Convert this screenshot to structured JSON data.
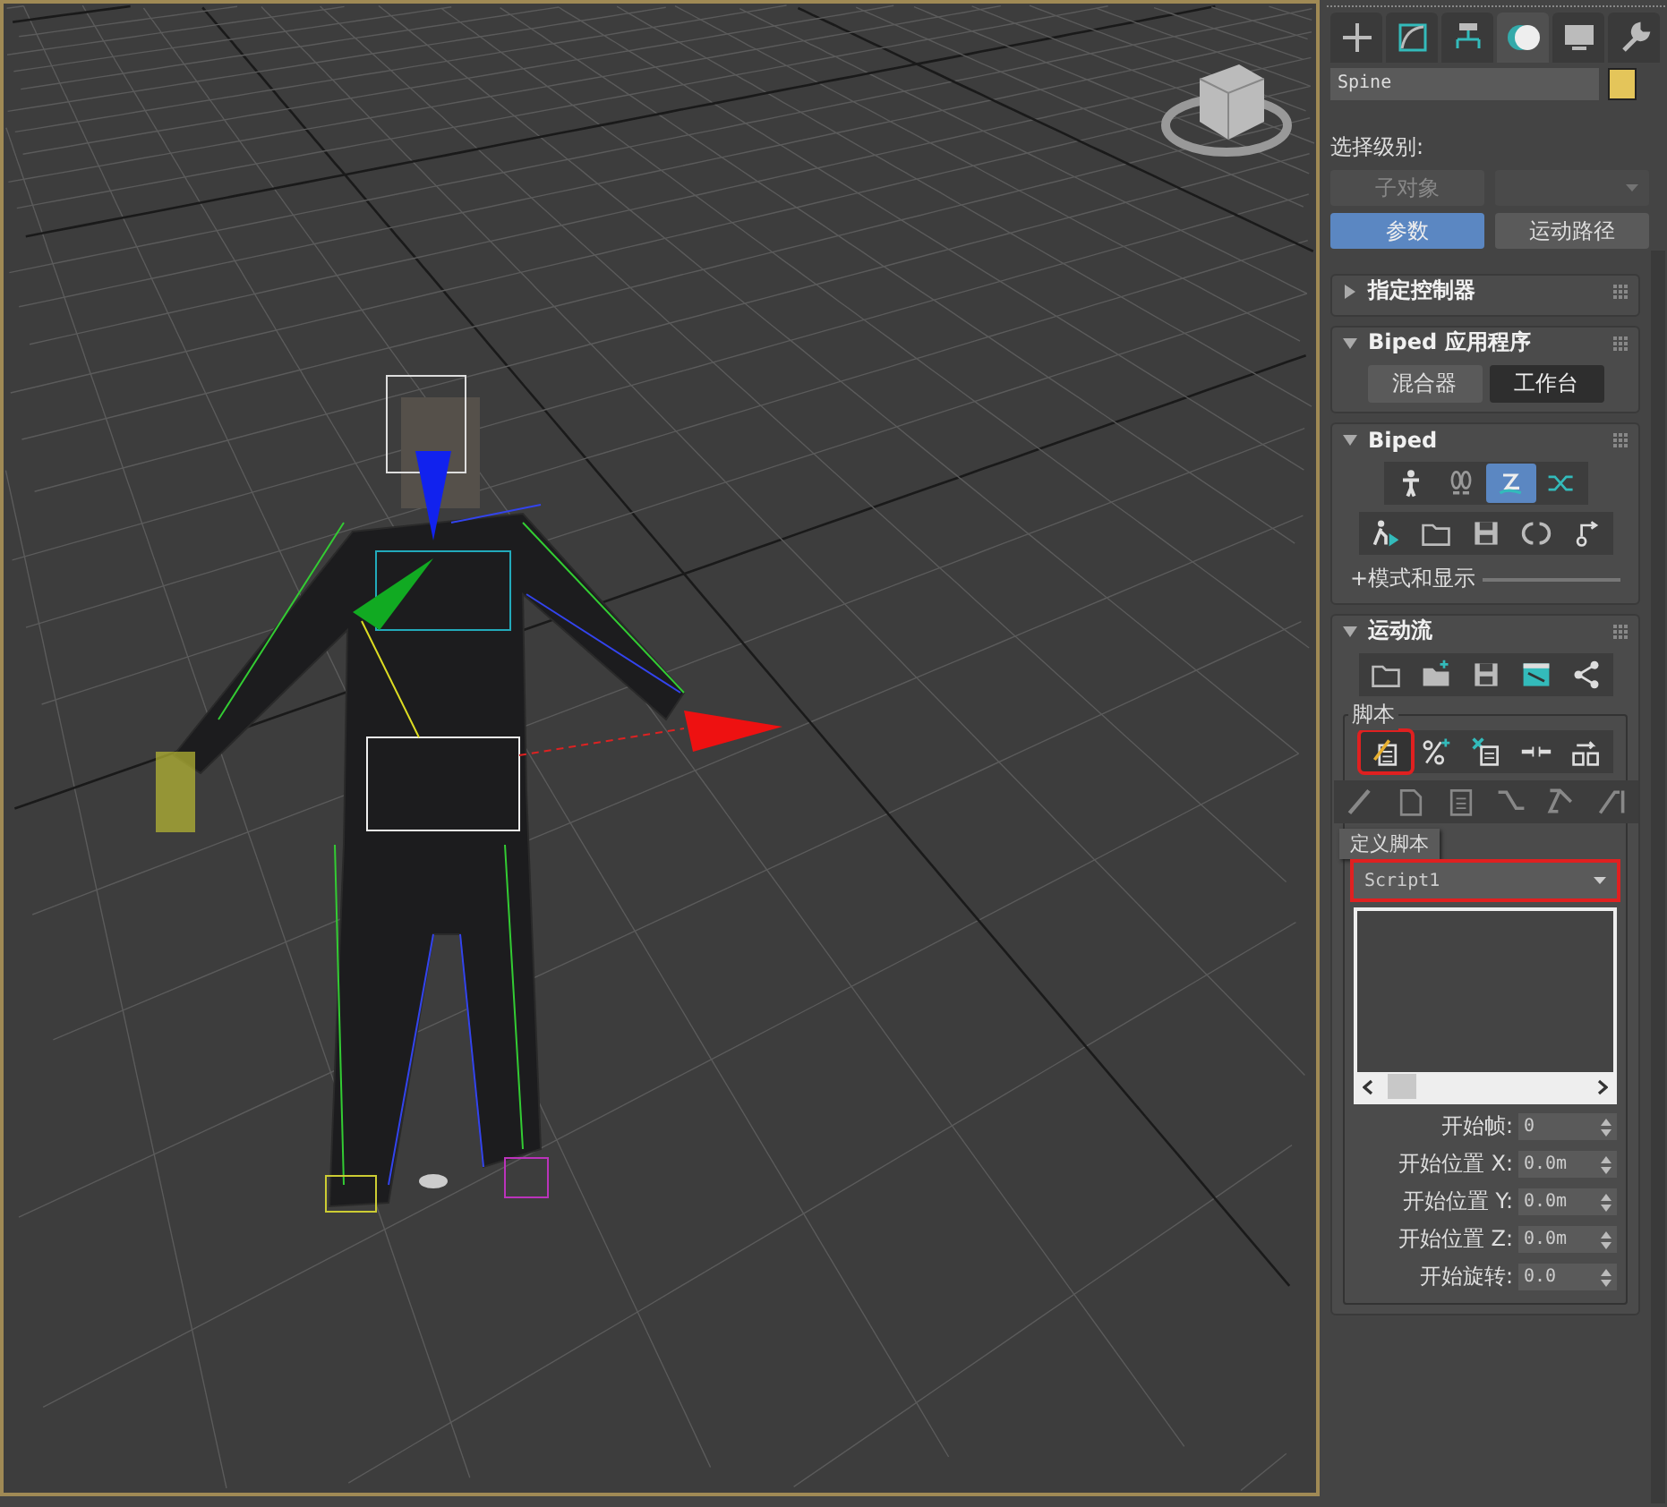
{
  "command_tabs": [
    {
      "kind": "create",
      "selected": false
    },
    {
      "kind": "modify",
      "selected": false
    },
    {
      "kind": "hierarchy",
      "selected": false
    },
    {
      "kind": "motion",
      "selected": true
    },
    {
      "kind": "display",
      "selected": false
    },
    {
      "kind": "utilities",
      "selected": false
    }
  ],
  "object": {
    "name": "Spine",
    "color": "#e4c55a"
  },
  "selection_level": {
    "label": "选择级别:",
    "sub_object": {
      "label": "子对象",
      "disabled": true
    },
    "dropdown": {
      "disabled": true
    }
  },
  "mode_buttons": [
    {
      "label": "参数",
      "selected": true
    },
    {
      "label": "运动路径",
      "selected": false
    }
  ],
  "assign_controller": {
    "title": "指定控制器",
    "expanded": false
  },
  "biped_apps": {
    "title": "Biped 应用程序",
    "expanded": true,
    "buttons": [
      {
        "label": "混合器",
        "selected": false
      },
      {
        "label": "工作台",
        "selected": true
      }
    ]
  },
  "biped": {
    "title": "Biped",
    "expanded": true,
    "modes": [
      {
        "kind": "figure",
        "selected": false
      },
      {
        "kind": "footsteps",
        "selected": false
      },
      {
        "kind": "motion-flow",
        "selected": true
      },
      {
        "kind": "mixer",
        "selected": false
      }
    ],
    "subsection": "+模式和显示"
  },
  "motion_flow": {
    "title": "运动流",
    "expanded": true,
    "script": {
      "title": "脚本",
      "tools": [
        {
          "kind": "define-script",
          "highlighted": true
        },
        {
          "kind": "percent",
          "highlighted": false
        },
        {
          "kind": "delete",
          "highlighted": false
        },
        {
          "kind": "insert",
          "highlighted": false
        },
        {
          "kind": "transition",
          "highlighted": false
        }
      ],
      "tooltip": "定义脚本",
      "dropdown": {
        "value": "Script1",
        "highlighted": true
      },
      "fields": [
        {
          "label": "开始帧:",
          "value": "0"
        },
        {
          "label": "开始位置 X:",
          "value": "0.0m"
        },
        {
          "label": "开始位置 Y:",
          "value": "0.0m"
        },
        {
          "label": "开始位置 Z:",
          "value": "0.0m"
        },
        {
          "label": "开始旋转:",
          "value": "0.0"
        }
      ]
    }
  }
}
